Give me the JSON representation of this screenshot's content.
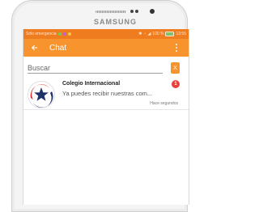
{
  "device": {
    "brand": "SAMSUNG"
  },
  "statusbar": {
    "left_text": "Sólo emergencia",
    "right_text": "100 %",
    "time": "13:55"
  },
  "appbar": {
    "title": "Chat"
  },
  "search": {
    "placeholder": "Buscar",
    "clear_label": "X"
  },
  "chats": [
    {
      "name": "Colegio Internacional",
      "message": "Ya puedes recibir nuestras com...",
      "time": "Hace segundos",
      "unread": "1"
    }
  ],
  "colors": {
    "statusbar": "#f07c20",
    "appbar": "#f7942d",
    "badge": "#e8403a",
    "logo_red": "#d8282f",
    "logo_navy": "#20306a"
  }
}
